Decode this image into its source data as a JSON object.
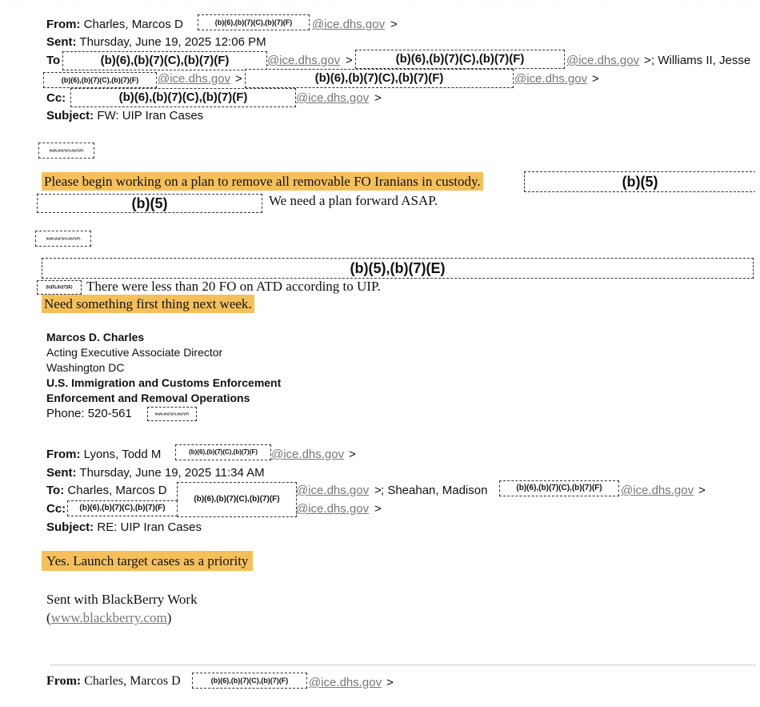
{
  "email1": {
    "from_label": "From:",
    "from_name": "Charles, Marcos D",
    "domain_open": "@ice.dhs.gov",
    "sent_label": "Sent:",
    "sent_value": "Thursday, June 19, 2025 12:06 PM",
    "to_label": "To",
    "to_extra": "; Williams II, Jesse",
    "cc_label": "Cc:",
    "subject_label": "Subject:",
    "subject_value": "FW: UIP Iran Cases",
    "body_line1": "Please begin working on a plan to remove all removable FO Iranians in custody.",
    "body_line2": "We need a plan forward ASAP.",
    "body_line3": "There were less than 20 FO on ATD according to UIP.",
    "body_line4": "Need something first thing next week."
  },
  "signature": {
    "name": "Marcos D. Charles",
    "title": "Acting Executive Associate Director",
    "location": "Washington DC",
    "agency": "U.S. Immigration and Customs Enforcement",
    "division": "Enforcement and Removal Operations",
    "phone": "Phone: 520-561"
  },
  "email2": {
    "from_label": "From:",
    "from_name": "Lyons, Todd M",
    "sent_label": "Sent:",
    "sent_value": "Thursday, June 19, 2025 11:34 AM",
    "to_label": "To:",
    "to_name1": "Charles, Marcos D",
    "to_name2": "; Sheahan, Madison",
    "cc_label": "Cc:",
    "subject_label": "Subject:",
    "subject_value": "RE: UIP Iran Cases",
    "body": "Yes. Launch target cases as a priority",
    "sent_with": "Sent with BlackBerry Work",
    "link_open": "(",
    "link": "www.blackberry.com",
    "link_close": ")"
  },
  "email3": {
    "from_label": "From:",
    "from_name": "Charles, Marcos D"
  },
  "redactions": {
    "privacy": "(b)(6),(b)(7)(C),(b)(7)(F)",
    "deliberative": "(b)(5)",
    "deliberative_law": "(b)(5),(b)(7)(E)"
  },
  "common": {
    "domain": "@ice.dhs.gov",
    "gt": ">"
  },
  "colors": {
    "highlight": "#f5c05a",
    "link_grey": "#777777"
  }
}
